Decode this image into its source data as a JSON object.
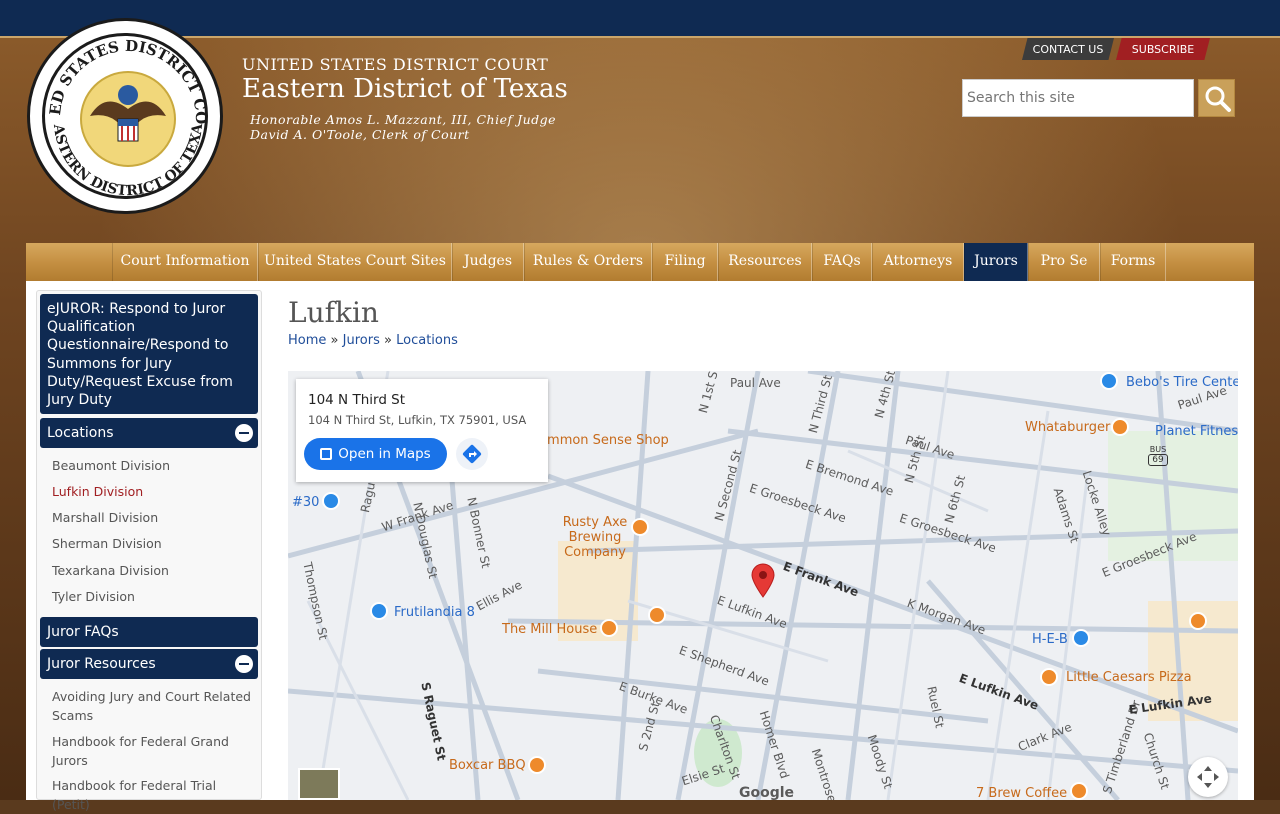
{
  "header": {
    "seal_text_top": "UNITED STATES DISTRICT COURT",
    "seal_text_bottom": "EASTERN DISTRICT OF TEXAS",
    "court_label": "UNITED STATES DISTRICT COURT",
    "district_name": "Eastern District of Texas",
    "judge_line": "Honorable Amos L. Mazzant, III, Chief Judge",
    "clerk_line": "David A. O'Toole, Clerk of Court",
    "contact_label": "CONTACT US",
    "subscribe_label": "SUBSCRIBE",
    "search_placeholder": "Search this site"
  },
  "nav": {
    "items": [
      "Court Information",
      "United States Court Sites",
      "Judges",
      "Rules & Orders",
      "Filing",
      "Resources",
      "FAQs",
      "Attorneys",
      "Jurors",
      "Pro Se",
      "Forms"
    ],
    "active": "Jurors"
  },
  "sidebar": {
    "ejuror": "eJUROR: Respond to Juror Qualification Questionnaire/Respond to Summons for Jury Duty/Request Excuse from Jury Duty",
    "locations_title": "Locations",
    "locations": [
      "Beaumont Division",
      "Lufkin Division",
      "Marshall Division",
      "Sherman Division",
      "Texarkana Division",
      "Tyler Division"
    ],
    "faqs_title": "Juror FAQs",
    "resources_title": "Juror Resources",
    "resources": [
      "Avoiding Jury and Court Related Scams",
      "Handbook for Federal Grand Jurors",
      "Handbook for Federal Trial (Petit)"
    ]
  },
  "main": {
    "title": "Lufkin",
    "breadcrumbs": [
      "Home",
      "Jurors",
      "Locations"
    ],
    "breadcrumb_sep": "»"
  },
  "map": {
    "card_title": "104 N Third St",
    "card_address": "104 N Third St, Lufkin, TX 75901, USA",
    "open_button": "Open in Maps",
    "logo": "Google",
    "streets": [
      "Paul Ave",
      "N 1st St",
      "N Third St",
      "N 4th St",
      "E Bremond Ave",
      "N 5th St",
      "E Groesbeck Ave",
      "N Second St",
      "N 6th St",
      "W Frank Ave",
      "N Douglas St",
      "N Bonner St",
      "Thompson St",
      "Ellis Ave",
      "E Frank Ave",
      "E Lufkin Ave",
      "K Morgan Ave",
      "E Shepherd Ave",
      "E Burke Ave",
      "S Raguet St",
      "S 2nd St",
      "Charlton St",
      "Homer Blvd",
      "Montrose",
      "Moody St",
      "Ruel St",
      "Clark Ave",
      "Elsie St",
      "Adams St",
      "Locke Alley",
      "S Timberland Dr",
      "Church St",
      "Raguet St"
    ],
    "pois": [
      "Bebo's Tire Center",
      "Whataburger",
      "Planet Fitness",
      "Common Sense Shop",
      "#30",
      "Rusty Axe Brewing Company",
      "Frutilandia 8",
      "The Mill House",
      "H-E-B",
      "Little Caesars Pizza",
      "Boxcar BBQ",
      "7 Brew Coffee"
    ],
    "highway_shield": "69",
    "highway_label": "BUS"
  }
}
